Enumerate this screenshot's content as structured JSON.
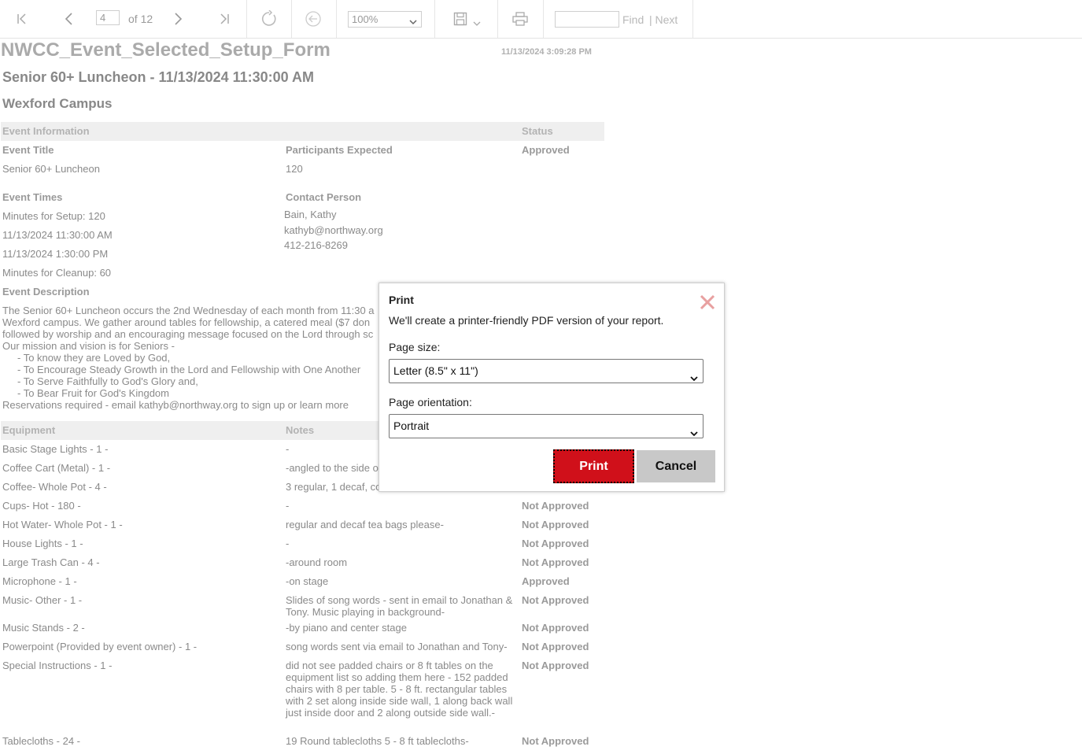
{
  "toolbar": {
    "page_value": "4",
    "page_total_label": "of 12",
    "zoom_value": "100%",
    "find_value": "",
    "find_label": "Find",
    "next_label": "| Next",
    "icons": [
      "first-page-icon",
      "prev-page-icon",
      "next-page-icon",
      "last-page-icon",
      "refresh-icon",
      "back-icon",
      "save-icon",
      "chevron-down-icon",
      "print-icon"
    ]
  },
  "report": {
    "title": "NWCC_Event_Selected_Setup_Form",
    "timestamp": "11/13/2024 3:09:28 PM",
    "event_heading": "Senior 60+ Luncheon - 11/13/2024 11:30:00 AM",
    "campus": "Wexford Campus",
    "section_info": {
      "col1": "Event Information",
      "col3": "Status"
    },
    "event_title_label": "Event Title",
    "event_title_value": "Senior 60+ Luncheon",
    "participants_label": "Participants Expected",
    "participants_value": "120",
    "status_value": "Approved",
    "event_times_label": "Event Times",
    "times": [
      "Minutes for Setup: 120",
      "11/13/2024 11:30:00 AM",
      "11/13/2024 1:30:00 PM",
      "Minutes for Cleanup: 60"
    ],
    "contact_label": "Contact Person",
    "contact": [
      "Bain, Kathy",
      "kathyb@northway.org",
      "412-216-8269"
    ],
    "description_label": "Event Description",
    "description_lines": [
      "The Senior 60+ Luncheon occurs the 2nd Wednesday of each month from 11:30 a",
      "Wexford campus.  We gather around tables for fellowship, a catered meal ($7 don",
      "followed by worship and an encouraging message focused on the Lord through sc",
      "Our mission and vision is for Seniors -",
      "     - To know they are Loved by God,",
      "     - To Encourage Steady Growth in the Lord and Fellowship with One Another",
      "     - To Serve Faithfully to God's Glory and,",
      "     - To Bear Fruit for God's Kingdom",
      "Reservations required - email kathyb@northway.org to sign up or learn more"
    ],
    "equipment_header": {
      "col1": "Equipment",
      "col2": "Notes"
    },
    "equipment": [
      {
        "item": "Basic Stage Lights  - 1 -",
        "notes": "-",
        "status": ""
      },
      {
        "item": "Coffee Cart (Metal)  - 1 -",
        "notes": "-angled to the side o",
        "status": ""
      },
      {
        "item": "Coffee- Whole Pot  - 4 -",
        "notes": "3 regular, 1 decaf, co",
        "status": ""
      },
      {
        "item": "Cups- Hot  - 180 -",
        "notes": "-",
        "status": "Not Approved"
      },
      {
        "item": "Hot Water- Whole Pot  - 1 -",
        "notes": "regular and decaf tea bags please-",
        "status": "Not Approved"
      },
      {
        "item": "House Lights  - 1 -",
        "notes": "-",
        "status": "Not Approved"
      },
      {
        "item": "Large Trash Can  - 4 -",
        "notes": "-around room",
        "status": "Not Approved"
      },
      {
        "item": "Microphone  - 1 -",
        "notes": "-on stage",
        "status": "Approved"
      },
      {
        "item": "Music- Other  - 1 -",
        "notes": "Slides of song words - sent in email to Jonathan & Tony.  Music playing in background-",
        "status": "Not Approved"
      },
      {
        "item": "Music Stands  - 2 -",
        "notes": "-by piano and center stage",
        "status": "Not Approved"
      },
      {
        "item": "Powerpoint (Provided by event owner)  - 1 -",
        "notes": "song words sent via email to Jonathan and Tony-",
        "status": "Not Approved"
      },
      {
        "item": "Special Instructions  - 1 -",
        "notes": "did not see padded chairs or 8 ft tables on the equipment list so adding them here -  152 padded chairs with 8 per table.  5 - 8 ft. rectangular tables with 2 set along inside side wall, 1 along back wall just inside door and 2 along outside side wall.-",
        "status": "Not Approved"
      },
      {
        "item": "Tablecloths  - 24 -",
        "notes": "19 Round tablecloths 5 - 8 ft tablecloths-",
        "status": "Not Approved"
      }
    ]
  },
  "dialog": {
    "title": "Print",
    "description": "We'll create a printer-friendly PDF version of your report.",
    "page_size_label": "Page size:",
    "page_size_value": "Letter (8.5\" x 11\")",
    "orientation_label": "Page orientation:",
    "orientation_value": "Portrait",
    "print_label": "Print",
    "cancel_label": "Cancel",
    "close_color": "#e8a0a0",
    "print_color": "#d0101a"
  }
}
